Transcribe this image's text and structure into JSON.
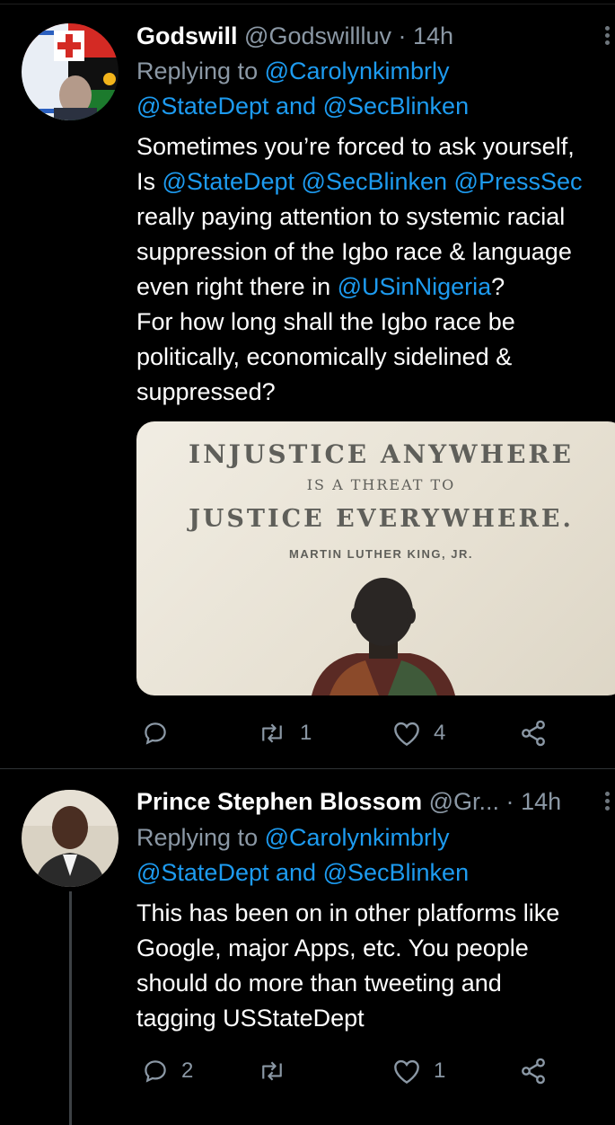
{
  "tweets": [
    {
      "name": "Godswill",
      "handle": "@Godswillluv",
      "dot": "·",
      "time": "14h",
      "replying_prefix": "Replying to",
      "reply_to_1": "@Carolynkimbrly",
      "reply_to_2": "@StateDept",
      "reply_and": "and",
      "reply_to_3": "@SecBlinken",
      "lines": {
        "l1": "Sometimes you’re forced to ask yourself,",
        "l2_pre": "Is ",
        "l2_m1": "@StateDept",
        "l2_m2": "@SecBlinken",
        "l2_m3": "@PressSec",
        "l3": "really paying attention to systemic racial",
        "l4": "suppression of the Igbo race & language",
        "l5_pre": "even right there in ",
        "l5_m": "@USinNigeria",
        "l5_post": "?",
        "l6": "For how long shall the Igbo race be",
        "l7": "politically, economically sidelined &",
        "l8": "suppressed?"
      },
      "image": {
        "line1": "INJUSTICE ANYWHERE",
        "line2": "IS A THREAT TO",
        "line3": "JUSTICE EVERYWHERE.",
        "line4": "MARTIN LUTHER KING, JR."
      },
      "actions": {
        "replies": "",
        "retweets": "1",
        "likes": "4"
      }
    },
    {
      "name": "Prince Stephen Blossom",
      "handle": "@Gr...",
      "dot": "·",
      "time": "14h",
      "replying_prefix": "Replying to",
      "reply_to_1": "@Carolynkimbrly",
      "reply_to_2": "@StateDept",
      "reply_and": "and",
      "reply_to_3": "@SecBlinken",
      "lines": {
        "l1": "This has been on in other platforms like",
        "l2": "Google, major Apps, etc. You people",
        "l3": "should do more than tweeting and",
        "l4": "tagging USStateDept"
      },
      "actions": {
        "replies": "2",
        "retweets": "",
        "likes": "1"
      }
    }
  ],
  "colors": {
    "background": "#000000",
    "link": "#1d9bf0",
    "muted": "#8b98a5"
  },
  "icons": [
    "reply-icon",
    "retweet-icon",
    "like-icon",
    "share-icon",
    "more-icon"
  ]
}
